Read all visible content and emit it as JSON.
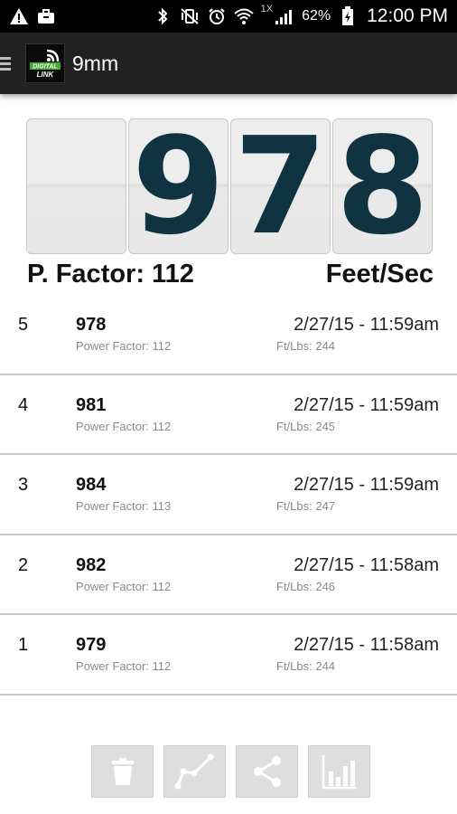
{
  "status_bar": {
    "network_label": "1X",
    "battery": "62%",
    "time": "12:00 PM"
  },
  "action_bar": {
    "title": "9mm",
    "logo_text": "DIGITAL LINK"
  },
  "counter": {
    "digits": [
      "",
      "9",
      "7",
      "8"
    ]
  },
  "summary": {
    "power_factor": "P. Factor: 112",
    "unit": "Feet/Sec"
  },
  "shots": [
    {
      "num": "5",
      "fps": "978",
      "pf": "Power Factor: 112",
      "date": "2/27/15 - 11:59am",
      "ftlbs": "Ft/Lbs: 244"
    },
    {
      "num": "4",
      "fps": "981",
      "pf": "Power Factor: 112",
      "date": "2/27/15 - 11:59am",
      "ftlbs": "Ft/Lbs: 245"
    },
    {
      "num": "3",
      "fps": "984",
      "pf": "Power Factor: 113",
      "date": "2/27/15 - 11:59am",
      "ftlbs": "Ft/Lbs: 247"
    },
    {
      "num": "2",
      "fps": "982",
      "pf": "Power Factor: 112",
      "date": "2/27/15 - 11:58am",
      "ftlbs": "Ft/Lbs: 246"
    },
    {
      "num": "1",
      "fps": "979",
      "pf": "Power Factor: 112",
      "date": "2/27/15 - 11:58am",
      "ftlbs": "Ft/Lbs: 244"
    }
  ],
  "toolbar": {
    "buttons": [
      "trash-icon",
      "line-graph-icon",
      "share-icon",
      "bar-chart-icon"
    ]
  },
  "colors": {
    "digit_color": "#0f3340",
    "action_bar_bg": "#212121"
  }
}
